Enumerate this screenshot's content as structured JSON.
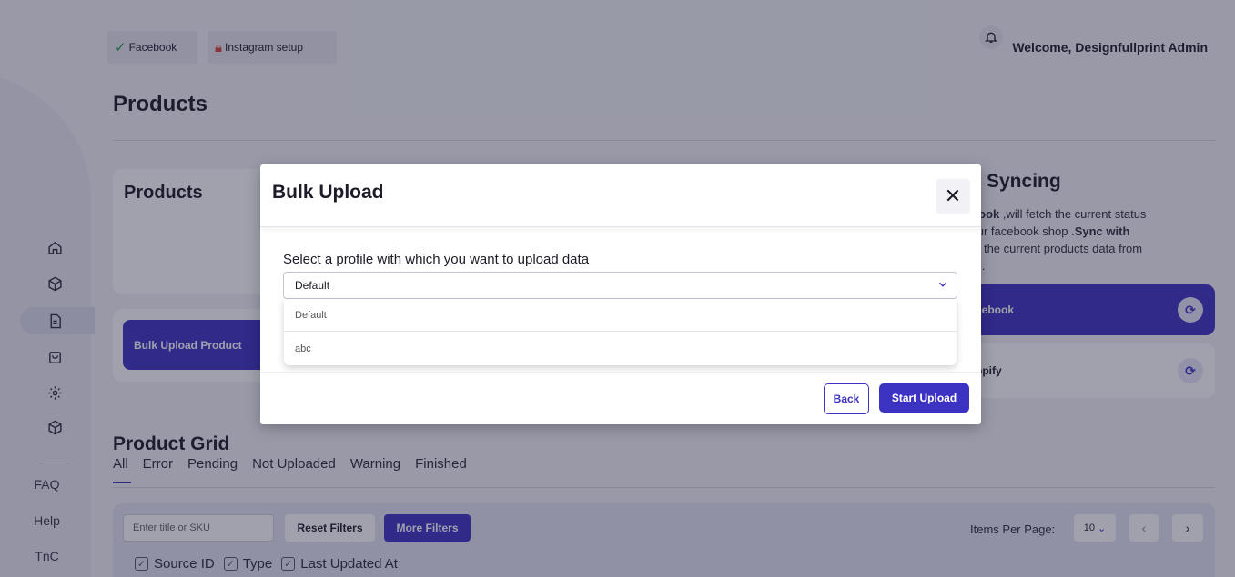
{
  "topbar": {
    "facebook_label": "Facebook",
    "instagram_label": "Instagram setup",
    "welcome": "Welcome, Designfullprint Admin"
  },
  "page": {
    "title": "Products"
  },
  "sidebar": {
    "icons": [
      "home-icon",
      "box-icon",
      "file-icon",
      "package-icon",
      "settings-icon",
      "cube-icon"
    ],
    "links": {
      "faq": "FAQ",
      "help": "Help",
      "tnc": "TnC"
    }
  },
  "products_card": {
    "title": "Products"
  },
  "bulk_card": {
    "button_label": "Bulk Upload Product"
  },
  "sync_card": {
    "title": "Syncing",
    "desc_bold_1": "ebook",
    "desc_1": " ,will fetch the current status",
    "desc_2": "your facebook shop .",
    "desc_bold_2": "Sync with",
    "desc_3": "tch the current products data from",
    "desc_4": "ore.",
    "fb_button": "cebook",
    "shop_button": "opify"
  },
  "product_grid": {
    "title": "Product Grid",
    "tabs": [
      "All",
      "Error",
      "Pending",
      "Not Uploaded",
      "Warning",
      "Finished"
    ],
    "search_placeholder": "Enter title or SKU",
    "reset_label": "Reset Filters",
    "more_label": "More Filters",
    "items_per_page_label": "Items Per Page:",
    "items_per_page_value": "10",
    "columns": [
      "Source ID",
      "Type",
      "Last Updated At"
    ]
  },
  "modal": {
    "title": "Bulk Upload",
    "label": "Select a profile with which you want to upload data",
    "selected": "Default",
    "options": [
      "Default",
      "abc"
    ],
    "back_label": "Back",
    "start_label": "Start Upload"
  },
  "colors": {
    "accent": "#3d33c2",
    "overlay": "rgba(30,32,60,0.42)"
  }
}
